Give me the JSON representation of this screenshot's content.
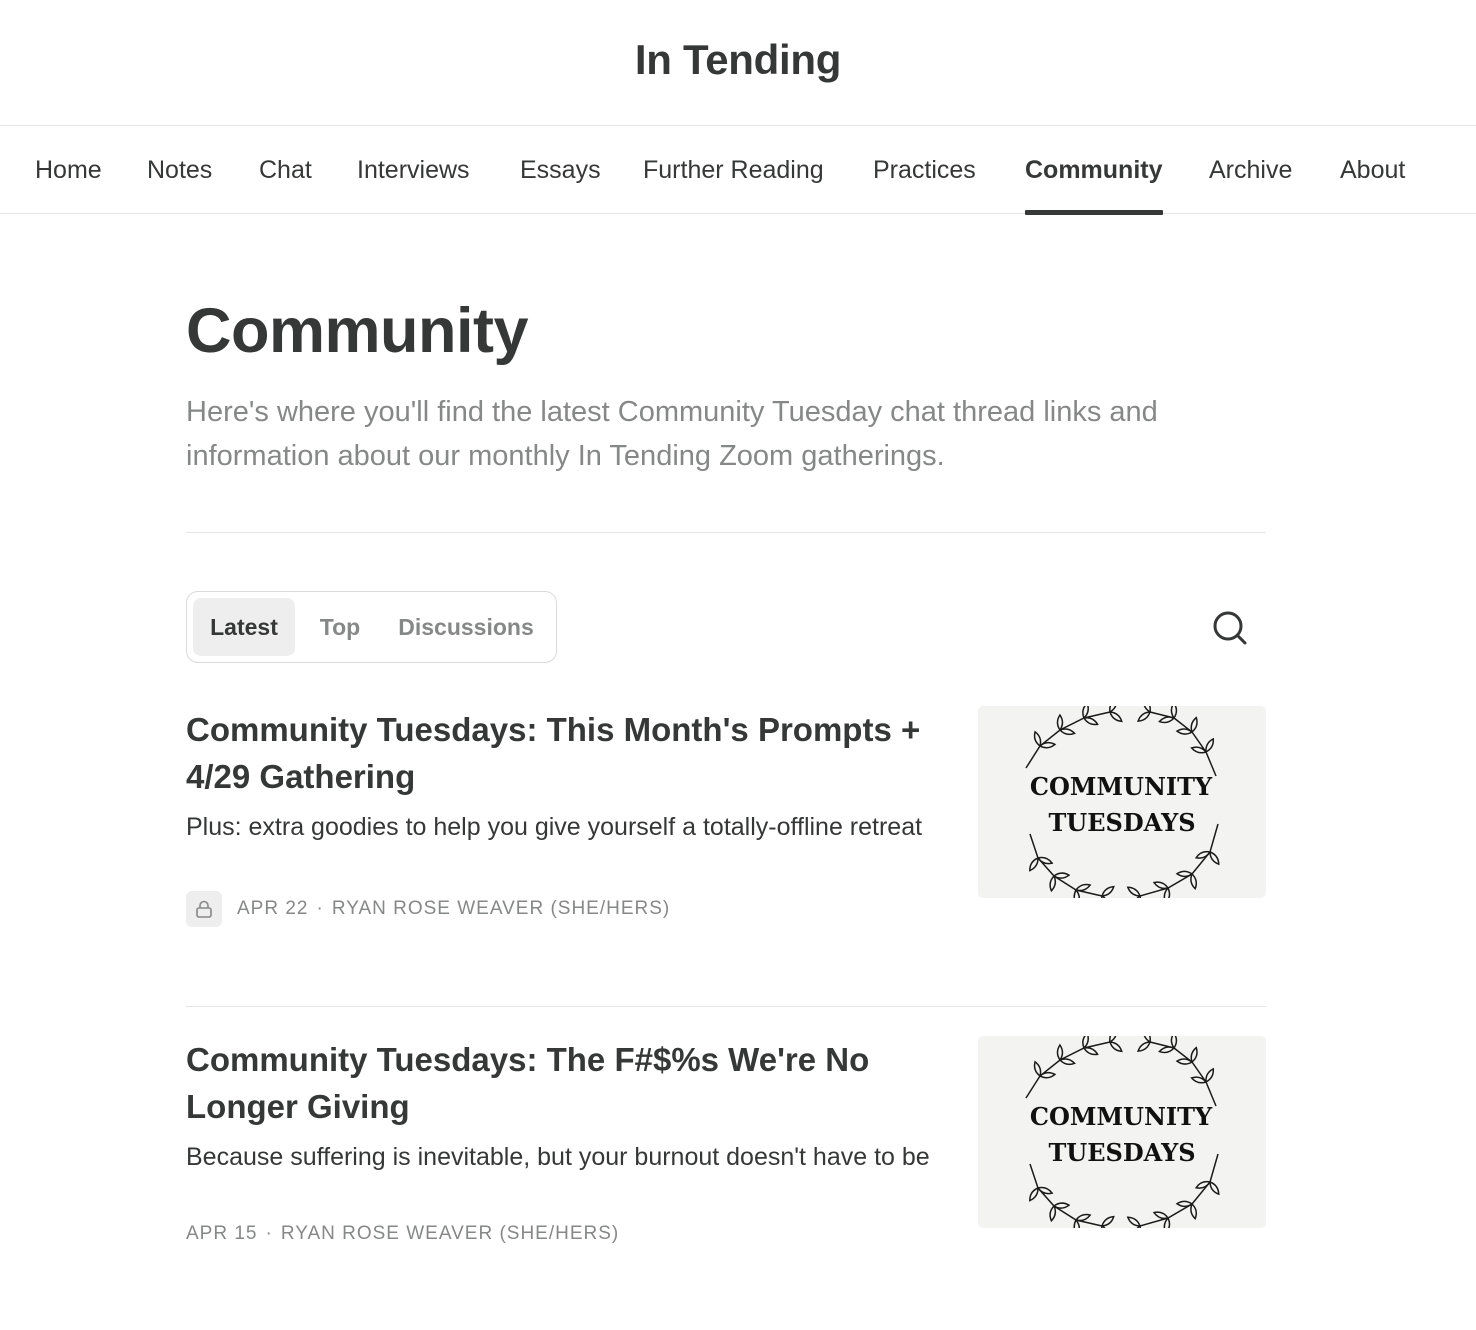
{
  "site": {
    "title": "In Tending"
  },
  "nav": {
    "items": [
      {
        "label": "Home"
      },
      {
        "label": "Notes"
      },
      {
        "label": "Chat"
      },
      {
        "label": "Interviews"
      },
      {
        "label": "Essays"
      },
      {
        "label": "Further Reading"
      },
      {
        "label": "Practices"
      },
      {
        "label": "Community"
      },
      {
        "label": "Archive"
      },
      {
        "label": "About"
      }
    ],
    "active": "Community"
  },
  "page": {
    "title": "Community",
    "description": "Here's where you'll find the latest Community Tuesday chat thread links and information about our monthly In Tending Zoom gatherings."
  },
  "filter_tabs": {
    "items": [
      {
        "label": "Latest"
      },
      {
        "label": "Top"
      },
      {
        "label": "Discussions"
      }
    ],
    "active": "Latest"
  },
  "search": {
    "icon": "search-icon"
  },
  "posts": [
    {
      "title": "Community Tuesdays: This Month's Prompts + 4/29 Gathering",
      "subtitle": "Plus: extra goodies to help you give yourself a totally-offline retreat",
      "date": "APR 22",
      "separator": "·",
      "author": "RYAN ROSE WEAVER (SHE/HERS)",
      "locked": true,
      "thumbnail_text": [
        "COMMUNITY",
        "TUESDAYS"
      ]
    },
    {
      "title": "Community Tuesdays: The F#$%s We're No Longer Giving",
      "subtitle": "Because suffering is inevitable, but your burnout doesn't have to be",
      "date": "APR 15",
      "separator": "·",
      "author": "RYAN ROSE WEAVER (SHE/HERS)",
      "locked": false,
      "thumbnail_text": [
        "COMMUNITY",
        "TUESDAYS"
      ]
    }
  ],
  "colors": {
    "text_primary": "#363737",
    "text_secondary": "#868787",
    "border": "#e6e6e6",
    "thumbnail_bg": "#f3f3f1"
  }
}
